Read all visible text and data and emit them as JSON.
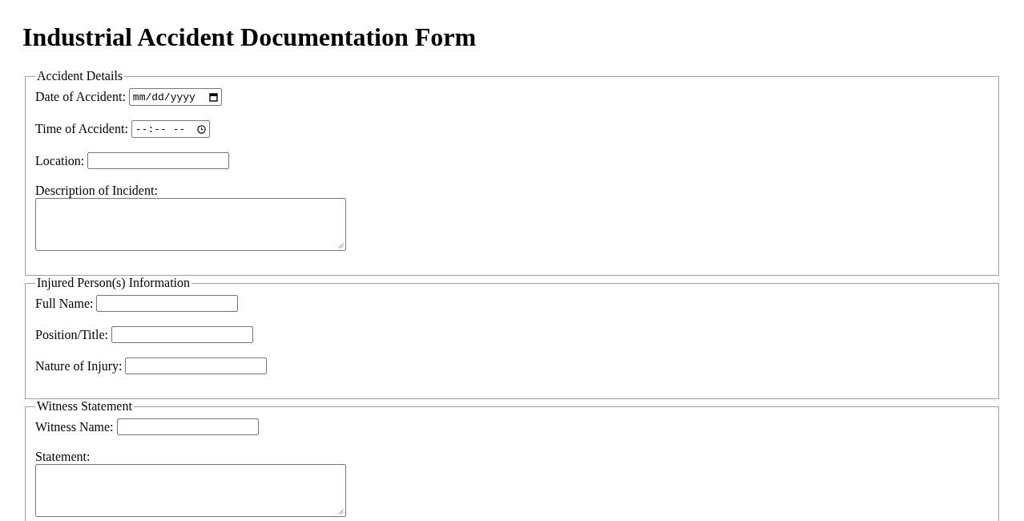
{
  "title": "Industrial Accident Documentation Form",
  "sections": [
    {
      "legend": "Accident Details",
      "fields": [
        {
          "kind": "date",
          "label": "Date of Accident:",
          "placeholder": "mm/dd/yyyy"
        },
        {
          "kind": "time",
          "label": "Time of Accident:",
          "placeholder": "--:-- --"
        },
        {
          "kind": "text",
          "label": "Location:"
        },
        {
          "kind": "textarea",
          "label": "Description of Incident:"
        }
      ]
    },
    {
      "legend": "Injured Person(s) Information",
      "fields": [
        {
          "kind": "text",
          "label": "Full Name:"
        },
        {
          "kind": "text",
          "label": "Position/Title:"
        },
        {
          "kind": "text",
          "label": "Nature of Injury:"
        }
      ]
    },
    {
      "legend": "Witness Statement",
      "fields": [
        {
          "kind": "text",
          "label": "Witness Name:"
        },
        {
          "kind": "textarea",
          "label": "Statement:"
        }
      ]
    }
  ]
}
